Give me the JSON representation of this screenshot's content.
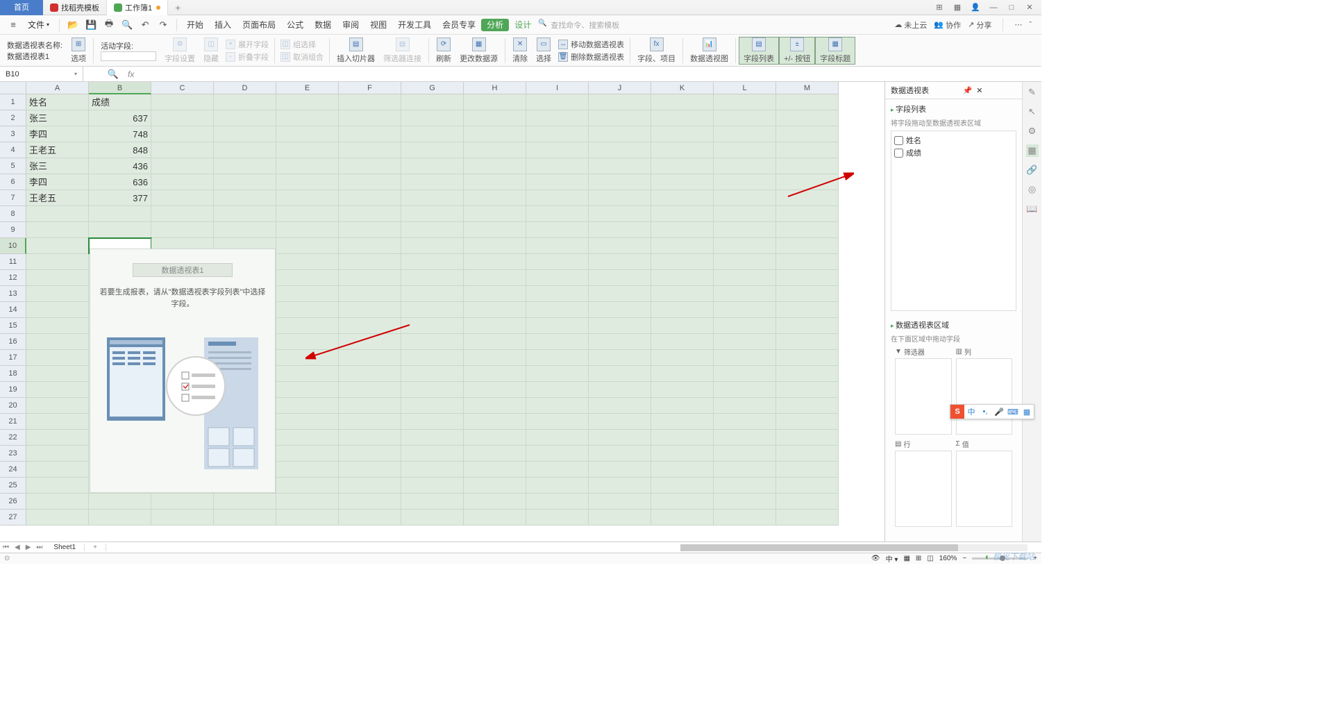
{
  "titlebar": {
    "home": "首页",
    "tabs": [
      {
        "icon_color": "#d03030",
        "label": "找稻壳模板"
      },
      {
        "icon_color": "#4fa656",
        "label": "工作簿1",
        "unsaved": true,
        "active": true
      }
    ],
    "add": "+"
  },
  "menubar": {
    "file": "文件",
    "items": [
      "开始",
      "插入",
      "页面布局",
      "公式",
      "数据",
      "审阅",
      "视图",
      "开发工具",
      "会员专享"
    ],
    "analysis": "分析",
    "design": "设计",
    "search_placeholder": "查找命令、搜索模板",
    "cloud": "未上云",
    "collab": "协作",
    "share": "分享"
  },
  "ribbon": {
    "name_label": "数据透视表名称:",
    "name_value": "数据透视表1",
    "options": "选项",
    "active_field": "活动字段:",
    "field_settings": "字段设置",
    "hide": "隐藏",
    "expand": "展开字段",
    "collapse": "折叠字段",
    "group_sel": "组选择",
    "ungroup": "取消组合",
    "slicer": "插入切片器",
    "filter_conn": "筛选器连接",
    "refresh": "刷新",
    "change_src": "更改数据源",
    "clear": "清除",
    "select": "选择",
    "move": "移动数据透视表",
    "delete": "删除数据透视表",
    "fields_items": "字段、项目",
    "pivot_chart": "数据透视图",
    "field_list": "字段列表",
    "pm_btn": "+/- 按钮",
    "field_hdr": "字段标题"
  },
  "namebox": "B10",
  "fx": "fx",
  "grid": {
    "cols": [
      "A",
      "B",
      "C",
      "D",
      "E",
      "F",
      "G",
      "H",
      "I",
      "J",
      "K",
      "L",
      "M"
    ],
    "rows": 27,
    "selected_row": 10,
    "selected_col": "B",
    "data": [
      [
        "姓名",
        "成绩"
      ],
      [
        "张三",
        "637"
      ],
      [
        "李四",
        "748"
      ],
      [
        "王老五",
        "848"
      ],
      [
        "张三",
        "436"
      ],
      [
        "李四",
        "636"
      ],
      [
        "王老五",
        "377"
      ]
    ]
  },
  "pivot_placeholder": {
    "title": "数据透视表1",
    "msg": "若要生成报表，请从\"数据透视表字段列表\"中选择字段。"
  },
  "sidepanel": {
    "title": "数据透视表",
    "field_list_hdr": "字段列表",
    "field_list_hint": "将字段拖动至数据透视表区域",
    "fields": [
      "姓名",
      "成绩"
    ],
    "area_hdr": "数据透视表区域",
    "area_hint": "在下面区域中拖动字段",
    "filter": "筛选器",
    "col": "列",
    "row": "行",
    "value": "值"
  },
  "sheettabs": {
    "sheet": "Sheet1",
    "add": "+"
  },
  "statusbar": {
    "zoom": "160%"
  },
  "ime": {
    "logo": "S",
    "lang": "中"
  },
  "watermark": "极光下载站"
}
